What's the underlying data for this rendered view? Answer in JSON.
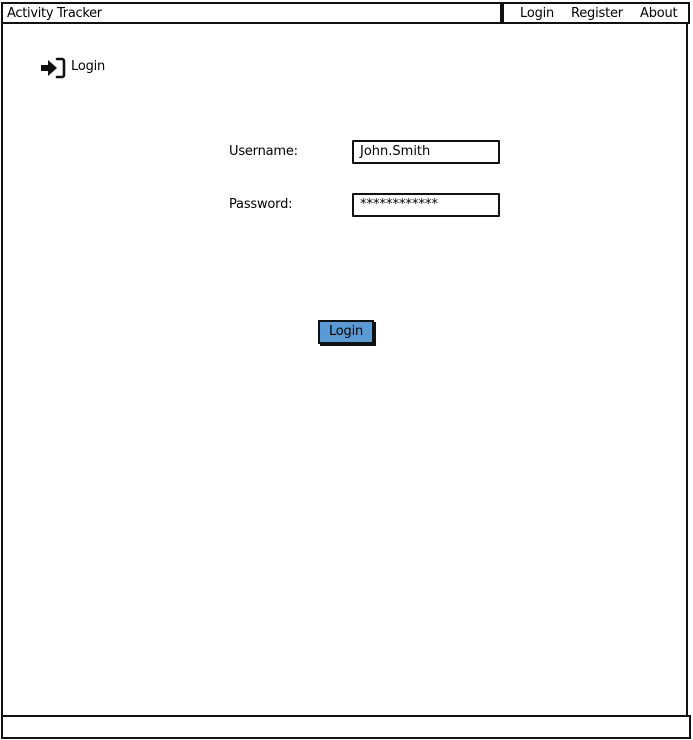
{
  "app": {
    "title": "Activity Tracker"
  },
  "nav": {
    "items": [
      "Login",
      "Register",
      "About"
    ]
  },
  "page": {
    "heading": "Login",
    "icon": "login-arrow-icon"
  },
  "form": {
    "username_label": "Username:",
    "username_value": "John.Smith",
    "password_label": "Password:",
    "password_value": "************"
  },
  "actions": {
    "login_label": "Login"
  },
  "colors": {
    "button": "#5b9bd5",
    "border": "#111111"
  }
}
